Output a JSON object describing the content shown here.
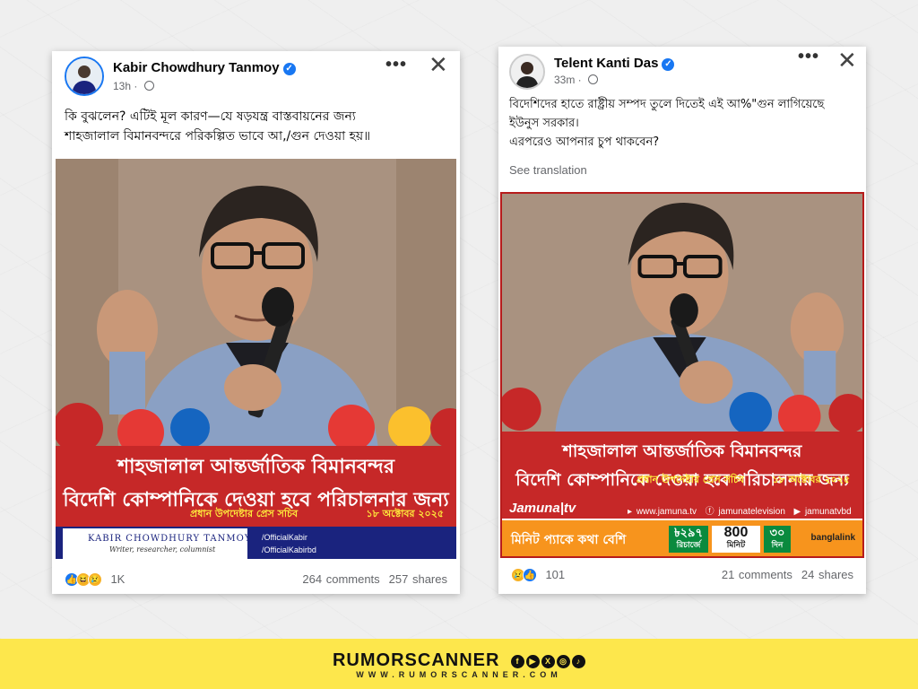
{
  "left_post": {
    "author": "Kabir Chowdhury Tanmoy",
    "time": "13h",
    "more_label": "•••",
    "close_label": "✕",
    "text_line1": "কি বুঝলেন? এটিই মূল কারণ—যে ষড়যন্ত্র বাস্তবায়নের জন্য",
    "text_line2": "শাহজালাল বিমানবন্দরে পরিকল্পিত ভাবে আ,/গুন দেওয়া হয়॥",
    "image": {
      "headline_line1": "শাহজালাল আন্তর্জাতিক বিমানবন্দর",
      "headline_line2": "বিদেশি কোম্পানিকে দেওয়া হবে পরিচালনার জন্য",
      "source": "প্রধান উপদেষ্টার প্রেস সচিব",
      "date": "১৮ অক্টোবর ২০২৫",
      "signature_name": "KABIR CHOWDHURY TANMOY",
      "signature_role": "Writer, researcher, columnist",
      "social1": "/OfficialKabir",
      "social2": "/OfficialKabirbd"
    },
    "reaction_count": "1K",
    "comments": "264 comments",
    "shares": "257 shares"
  },
  "right_post": {
    "author": "Telent Kanti Das",
    "time": "33m",
    "more_label": "•••",
    "close_label": "✕",
    "text_line1": "বিদেশিদের হাতে রাষ্ট্রীয় সম্পদ তুলে দিতেই এই আ%\"গুন লাগিয়েছে",
    "text_line2": "ইউনুস সরকার।",
    "text_line3": "এরপরেও আপনার চুপ থাকবেন?",
    "see_translation": "See translation",
    "image": {
      "headline_line1": "শাহজালাল আন্তর্জাতিক বিমানবন্দর",
      "headline_line2": "বিদেশি কোম্পানিকে দেওয়া হবে পরিচালনার জন্য",
      "source": "প্রধান উপদেষ্টার প্রেস সচিব",
      "date": "১৮ অক্টোবর ২০২৫",
      "channel": "Jamuna|tv",
      "link_web": "www.jamuna.tv",
      "link_fb": "jamunatelevision",
      "link_yt": "jamunatvbd",
      "ad_text": "মিনিট প্যাকে কথা বেশি",
      "ad_price": "৳২৯৭",
      "ad_price_sub": "রিচার্জে",
      "ad_minutes": "800",
      "ad_minutes_sub": "মিনিট",
      "ad_days": "৩০",
      "ad_days_sub": "দিন",
      "ad_brand": "banglalink"
    },
    "reaction_count": "101",
    "comments": "21 comments",
    "shares": "24 shares"
  },
  "footer": {
    "brand": "RUMORSCANNER",
    "website": "WWW.RUMORSCANNER.COM"
  },
  "colors": {
    "facebook_blue": "#1877f2",
    "banner_red": "#c62828",
    "footer_yellow": "#fde74c"
  }
}
